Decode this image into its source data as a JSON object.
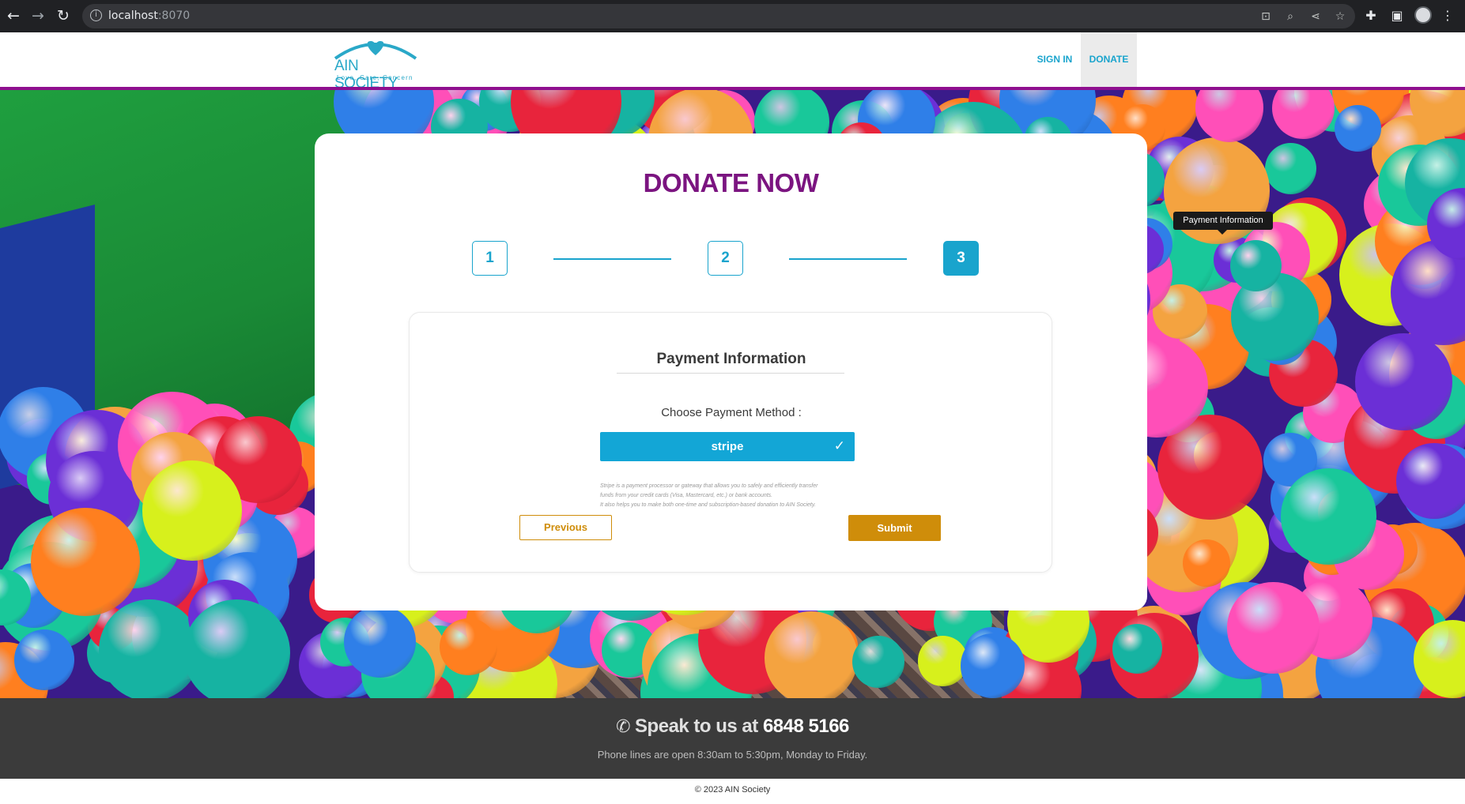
{
  "browser": {
    "url_host": "localhost",
    "url_port": ":8070",
    "icons": [
      "back-icon",
      "forward-icon",
      "reload-icon",
      "site-info-icon",
      "translate-icon",
      "zoom-icon",
      "share-icon",
      "bookmark-star-icon",
      "extensions-icon",
      "side-panel-icon",
      "profile-avatar",
      "menu-kebab-icon"
    ]
  },
  "header": {
    "logo_text": "AIN SOCIETY",
    "logo_tagline": "Love, Care, Concern",
    "nav": {
      "sign_in": "SIGN IN",
      "donate": "DONATE"
    }
  },
  "donate_form": {
    "title": "DONATE NOW",
    "steps": [
      "1",
      "2",
      "3"
    ],
    "active_step": 3,
    "section_title": "Payment Information",
    "choose_label": "Choose Payment Method :",
    "payment_method": "stripe",
    "payment_description": [
      "Stripe is a payment processor or gateway that allows you to safely and efficiently transfer",
      "funds from your credit cards (Visa, Mastercard, etc.) or bank accounts.",
      "It also helps you to make both one-time and subscription-based donation to AIN Society."
    ],
    "previous_label": "Previous",
    "submit_label": "Submit"
  },
  "tooltip": {
    "text": "Payment Information"
  },
  "footer": {
    "speak_prefix": "Speak to us at",
    "phone": "6848 5166",
    "hours": "Phone lines are open 8:30am to 5:30pm, Monday to Friday.",
    "copyright": "© 2023 AIN Society"
  },
  "colors": {
    "brand_purple": "#7b1480",
    "brand_blue": "#19a4cd",
    "brand_gold": "#cf8d0a",
    "header_rule": "#8f0f8f",
    "footer_bg": "#3b3b3b"
  }
}
